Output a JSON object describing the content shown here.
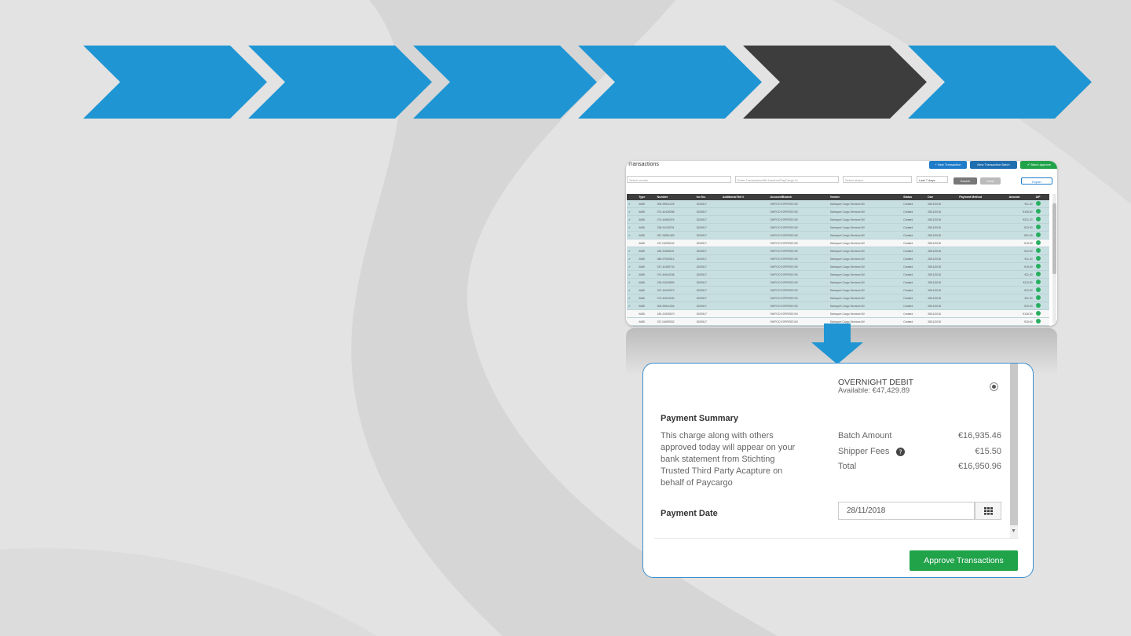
{
  "colors": {
    "step_active": "#1f95d3",
    "step_current": "#3d3d3d",
    "accent_green": "#21a34a",
    "panel_border": "#3b8ed0"
  },
  "process_steps": {
    "count": 6,
    "current_index": 4
  },
  "transactions": {
    "title": "Transactions",
    "buttons": {
      "new_transaction": "+ New Transaction",
      "new_batch": "New Transaction Batch",
      "batch_approve": "✔ Batch approve",
      "search": "Search",
      "clear": "Clear",
      "export": "Export"
    },
    "filters": {
      "vendor_placeholder": "Select vendor",
      "search_placeholder": "Enter Transaction/Bill Number/PayCargo Id",
      "status_placeholder": "Select status",
      "period": "Last 7 days"
    },
    "columns": [
      "",
      "Type",
      "Number",
      "Inv No.",
      "Additional Ref #",
      "Account/Branch",
      "Vendor",
      "Status",
      "Due",
      "Payment Method",
      "Amount",
      "A/P"
    ],
    "rows": [
      {
        "sel": true,
        "type": "AWB",
        "number": "006-99641225",
        "inv": "3200517",
        "acct": "SHIPCO EXPRESS BV",
        "vendor": "Swissport Cargo Services BV",
        "status": "Created",
        "due": "28/11/2018",
        "amount": "€11.40"
      },
      {
        "sel": true,
        "type": "AWB",
        "number": "074-42449286",
        "inv": "3200517",
        "acct": "SHIPCO EXPRESS BV",
        "vendor": "Swissport Cargo Services BV",
        "status": "Created",
        "due": "28/11/2018",
        "amount": "€105.80"
      },
      {
        "sel": true,
        "type": "AWB",
        "number": "074-44984376",
        "inv": "3200517",
        "acct": "SHIPCO EXPRESS BV",
        "vendor": "Swissport Cargo Services BV",
        "status": "Created",
        "due": "28/11/2018",
        "amount": "€231.20"
      },
      {
        "sel": true,
        "type": "AWB",
        "number": "235-91105276",
        "inv": "3200517",
        "acct": "SHIPCO EXPRESS BV",
        "vendor": "Swissport Cargo Services BV",
        "status": "Created",
        "due": "28/11/2018",
        "amount": "€23.90"
      },
      {
        "sel": true,
        "type": "AWB",
        "number": "057-28981483",
        "inv": "3200517",
        "acct": "SHIPCO EXPRESS BV",
        "vendor": "Swissport Cargo Services BV",
        "status": "Created",
        "due": "28/11/2018",
        "amount": "€51.80"
      },
      {
        "sel": false,
        "type": "AWB",
        "number": "157-04059152",
        "inv": "3200517",
        "acct": "SHIPCO EXPRESS BV",
        "vendor": "Swissport Cargo Services BV",
        "status": "Created",
        "due": "28/11/2018",
        "amount": "€15.60"
      },
      {
        "sel": true,
        "type": "AWB",
        "number": "180-31908115",
        "inv": "3200517",
        "acct": "SHIPCO EXPRESS BV",
        "vendor": "Swissport Cargo Services BV",
        "status": "Created",
        "due": "28/11/2018",
        "amount": "€22.80"
      },
      {
        "sel": true,
        "type": "AWB",
        "number": "086-97930514",
        "inv": "3200517",
        "acct": "SHIPCO EXPRESS BV",
        "vendor": "Swissport Cargo Services BV",
        "status": "Created",
        "due": "28/11/2018",
        "amount": "€11.40"
      },
      {
        "sel": true,
        "type": "AWB",
        "number": "157-42459733",
        "inv": "3200517",
        "acct": "SHIPCO EXPRESS BV",
        "vendor": "Swissport Cargo Services BV",
        "status": "Created",
        "due": "28/11/2018",
        "amount": "€15.60"
      },
      {
        "sel": true,
        "type": "AWB",
        "number": "074-44944238",
        "inv": "3200517",
        "acct": "SHIPCO EXPRESS BV",
        "vendor": "Swissport Cargo Services BV",
        "status": "Created",
        "due": "28/11/2018",
        "amount": "€11.40"
      },
      {
        "sel": true,
        "type": "AWB",
        "number": "235-91549899",
        "inv": "3200517",
        "acct": "SHIPCO EXPRESS BV",
        "vendor": "Swissport Cargo Services BV",
        "status": "Created",
        "due": "28/11/2018",
        "amount": "€113.80"
      },
      {
        "sel": true,
        "type": "AWB",
        "number": "157-44039973",
        "inv": "3200517",
        "acct": "SHIPCO EXPRESS BV",
        "vendor": "Swissport Cargo Services BV",
        "status": "Created",
        "due": "28/11/2018",
        "amount": "€22.80"
      },
      {
        "sel": true,
        "type": "AWB",
        "number": "074-44944230",
        "inv": "3200517",
        "acct": "SHIPCO EXPRESS BV",
        "vendor": "Swissport Cargo Services BV",
        "status": "Created",
        "due": "28/11/2018",
        "amount": "€11.40"
      },
      {
        "sel": true,
        "type": "AWB",
        "number": "006-99641264",
        "inv": "3200517",
        "acct": "SHIPCO EXPRESS BV",
        "vendor": "Swissport Cargo Services BV",
        "status": "Created",
        "due": "28/11/2018",
        "amount": "€23.90"
      },
      {
        "sel": false,
        "type": "AWB",
        "number": "180-31905570",
        "inv": "3200517",
        "acct": "SHIPCO EXPRESS BV",
        "vendor": "Swissport Cargo Services BV",
        "status": "Created",
        "due": "28/11/2018",
        "amount": "€126.90"
      },
      {
        "sel": false,
        "type": "AWB",
        "number": "157-04059032",
        "inv": "3200517",
        "acct": "SHIPCO EXPRESS BV",
        "vendor": "Swissport Cargo Services BV",
        "status": "Created",
        "due": "28/11/2018",
        "amount": "€15.60"
      }
    ]
  },
  "payment_panel": {
    "method_name": "OVERNIGHT DEBIT",
    "method_available": "Available: €47,429.89",
    "summary_heading": "Payment Summary",
    "summary_text": [
      "This charge along with others",
      "approved today will appear on your",
      "bank statement from Stichting",
      "Trusted Third Party Acapture on",
      "behalf of Paycargo"
    ],
    "batch_amount_label": "Batch Amount",
    "batch_amount": "€16,935.46",
    "fees_label": "Shipper Fees",
    "fees": "€15.50",
    "total_label": "Total",
    "total": "€16,950.96",
    "date_label": "Payment Date",
    "date_value": "28/11/2018",
    "approve_label": "Approve Transactions"
  }
}
